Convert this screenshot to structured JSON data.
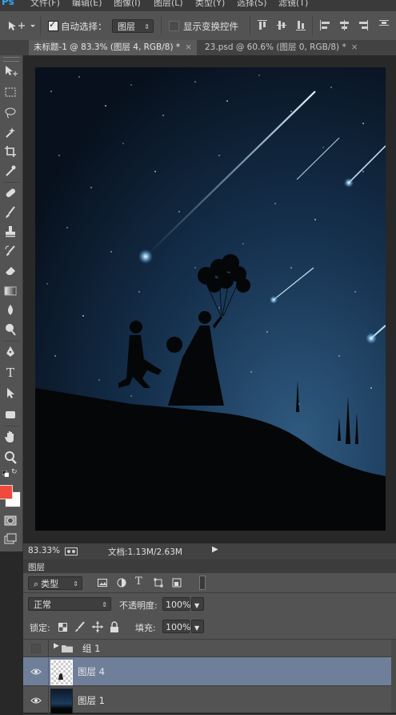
{
  "menu": {
    "logo": "Ps",
    "items": [
      "文件(F)",
      "编辑(E)",
      "图像(I)",
      "图层(L)",
      "类型(Y)",
      "选择(S)",
      "滤镜(T)"
    ]
  },
  "options": {
    "auto_select_label": "自动选择：",
    "auto_select_checked": true,
    "auto_select_target": "图层",
    "show_transform_label": "显示变换控件",
    "show_transform_checked": false
  },
  "tabs": [
    {
      "label": "未标题-1 @ 83.3% (图层 4, RGB/8) *",
      "active": true
    },
    {
      "label": "23.psd @ 60.6% (图层 0, RGB/8) *",
      "active": false
    }
  ],
  "colors": {
    "foreground": "#f04a3c",
    "background": "#ffffff"
  },
  "status": {
    "zoom": "83.33%",
    "doc": "文档:1.13M/2.63M"
  },
  "layers_panel": {
    "title": "图层",
    "filter_kind": "类型",
    "blend_mode": "正常",
    "opacity_label": "不透明度:",
    "opacity_value": "100%",
    "lock_label": "锁定:",
    "fill_label": "填充:",
    "fill_value": "100%",
    "layers": [
      {
        "name": "组 1",
        "type": "group",
        "visible": false,
        "selected": false
      },
      {
        "name": "图层 4",
        "type": "layer",
        "visible": true,
        "selected": true
      },
      {
        "name": "图层 1",
        "type": "layer",
        "visible": true,
        "selected": false
      }
    ]
  }
}
